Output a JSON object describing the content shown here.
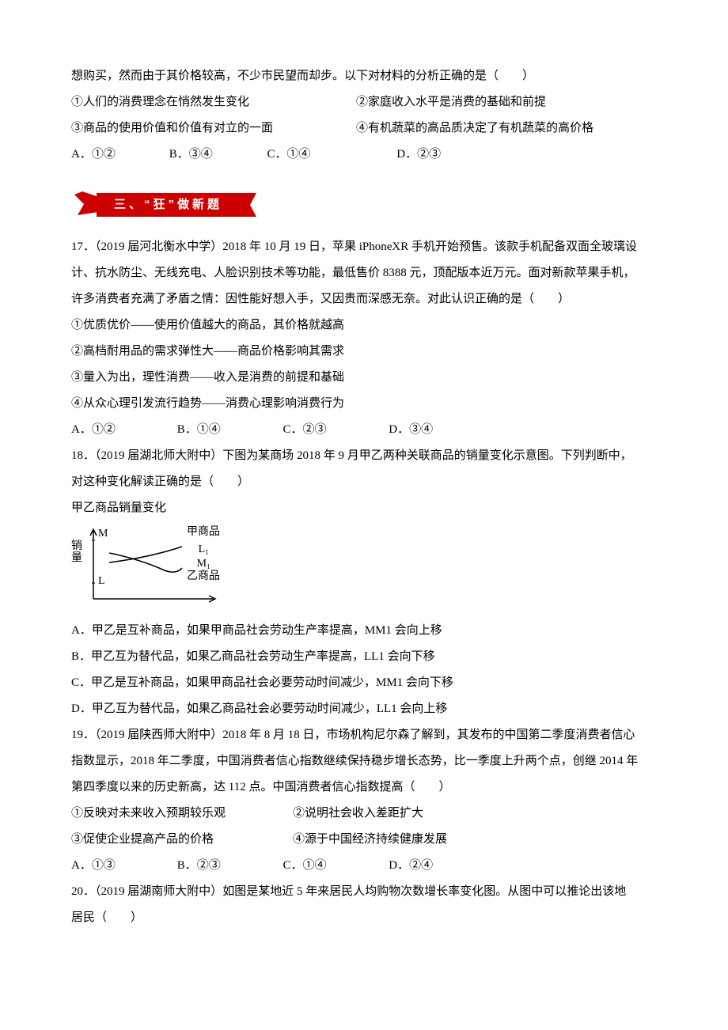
{
  "top": {
    "line1": "想购买，然而由于其价格较高，不少市民望而却步。以下对材料的分析正确的是（　　）",
    "stmt1_left": "①人们的消费理念在悄然发生变化",
    "stmt1_right": "②家庭收入水平是消费的基础和前提",
    "stmt2_left": "③商品的使用价值和价值有对立的一面",
    "stmt2_right": "④有机蔬菜的高品质决定了有机蔬菜的高价格",
    "options": {
      "A": "A．①②",
      "B": "B．③④",
      "C": "C．①④",
      "D": "D．②③"
    }
  },
  "banner": "三、“狂”做新题",
  "q17": {
    "p1": "17．（2019 届河北衡水中学）2018 年 10 月 19 日，苹果 iPhoneXR 手机开始预售。该款手机配备双面全玻璃设",
    "p2": "计、抗水防尘、无线充电、人脸识别技术等功能，最低售价 8388 元，顶配版本近万元。面对新款苹果手机，",
    "p3": "许多消费者充满了矛盾之情：因性能好想入手，又因贵而深感无奈。对此认识正确的是（　　）",
    "s1": "①优质优价——使用价值越大的商品，其价格就越高",
    "s2": "②高档耐用品的需求弹性大——商品价格影响其需求",
    "s3": "③量入为出，理性消费——收入是消费的前提和基础",
    "s4": "④从众心理引发流行趋势——消费心理影响消费行为",
    "options": {
      "A": "A．①②",
      "B": "B．①④",
      "C": "C．②③",
      "D": "D．③④"
    }
  },
  "q18": {
    "p1": "18．（2019 届湖北师大附中）下图为某商场 2018 年 9 月甲乙两种关联商品的销量变化示意图。下列判断中，",
    "p2": "对这种变化解读正确的是（　　）",
    "caption": "甲乙商品销量变化",
    "chart_labels": {
      "yaxis": "销量",
      "M": "M",
      "L": "L",
      "seriesA": "甲商品",
      "L1": "L₁",
      "M1": "M₁",
      "seriesB": "乙商品"
    },
    "optA": "A．甲乙是互补商品，如果甲商品社会劳动生产率提高，MM1 会向上移",
    "optB": "B．甲乙互为替代品，如果乙商品社会劳动生产率提高，LL1 会向下移",
    "optC": "C．甲乙是互补商品，如果甲商品社会必要劳动时间减少，MM1 会向下移",
    "optD": "D．甲乙互为替代品，如果乙商品社会必要劳动时间减少，LL1 会向上移"
  },
  "q19": {
    "p1": "19．（2019 届陕西师大附中）2018 年 8 月 18 日，市场机构尼尔森了解到，其发布的中国第二季度消费者信心",
    "p2": "指数显示，2018 年二季度，中国消费者信心指数继续保持稳步增长态势，比一季度上升两个点，创继 2014 年",
    "p3": "第四季度以来的历史新高，达 112 点。中国消费者信心指数提高（　　）",
    "s1_left": "①反映对未来收入预期较乐观",
    "s1_right": "②说明社会收入差距扩大",
    "s2_left": "③促使企业提高产品的价格",
    "s2_right": "④源于中国经济持续健康发展",
    "options": {
      "A": "A．①③",
      "B": "B．②③",
      "C": "C．①④",
      "D": "D．②④"
    }
  },
  "q20": {
    "p1": "20．（2019 届湖南师大附中）如图是某地近 5 年来居民人均购物次数增长率变化图。从图中可以推论出该地",
    "p2": "居民（　　）"
  },
  "chart_data": {
    "type": "line",
    "title": "甲乙商品销量变化",
    "xlabel": "",
    "ylabel": "销量",
    "y_markers": [
      "M",
      "L"
    ],
    "series": [
      {
        "name": "甲商品",
        "start": "M",
        "end": "L₁",
        "trend": "rising"
      },
      {
        "name": "乙商品",
        "start": "L",
        "end": "M₁",
        "trend": "falling_then_slight_rise"
      }
    ],
    "note": "两条曲线在图中部相交；甲商品曲线自较低处上升，乙商品曲线总体下降后末端略升"
  }
}
